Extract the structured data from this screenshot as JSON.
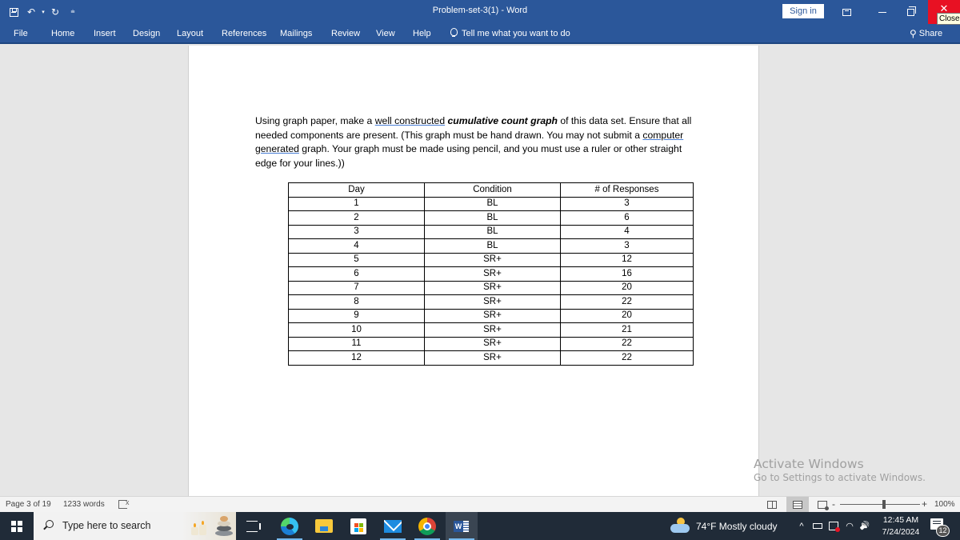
{
  "window": {
    "title": "Problem-set-3(1)  -  Word",
    "sign_in": "Sign in",
    "close_tooltip": "Close",
    "quick_access": [
      "save-icon",
      "undo-icon",
      "redo-icon",
      "customize-icon"
    ]
  },
  "ribbon": {
    "tabs": [
      "File",
      "Home",
      "Insert",
      "Design",
      "Layout",
      "References",
      "Mailings",
      "Review",
      "View",
      "Help"
    ],
    "tell_me": "Tell me what you want to do",
    "share": "Share"
  },
  "document": {
    "paragraph": {
      "p1": "Using graph paper, make a ",
      "u1": "well constructed",
      "p2": " ",
      "bold": "cumulative count graph",
      "p3": " of this data set.  Ensure that all needed components are present.  (This graph must be hand drawn.  You may not submit a ",
      "u2": "computer generated",
      "p4": " graph.  Your graph must be made using pencil, and you must use a ruler or other straight edge for your lines.))"
    },
    "table": {
      "headers": [
        "Day",
        "Condition",
        "# of Responses"
      ],
      "rows": [
        [
          "1",
          "BL",
          "3"
        ],
        [
          "2",
          "BL",
          "6"
        ],
        [
          "3",
          "BL",
          "4"
        ],
        [
          "4",
          "BL",
          "3"
        ],
        [
          "5",
          "SR+",
          "12"
        ],
        [
          "6",
          "SR+",
          "16"
        ],
        [
          "7",
          "SR+",
          "20"
        ],
        [
          "8",
          "SR+",
          "22"
        ],
        [
          "9",
          "SR+",
          "20"
        ],
        [
          "10",
          "SR+",
          "21"
        ],
        [
          "11",
          "SR+",
          "22"
        ],
        [
          "12",
          "SR+",
          "22"
        ]
      ]
    }
  },
  "watermark": {
    "title": "Activate Windows",
    "subtitle": "Go to Settings to activate Windows."
  },
  "statusbar": {
    "page": "Page 3 of 19",
    "words": "1233 words",
    "zoom_minus": "-",
    "zoom_plus": "+",
    "zoom_percent": "100%",
    "zoom_level": 1.0
  },
  "taskbar": {
    "search_placeholder": "Type here to search",
    "apps": [
      "task-view",
      "edge",
      "file-explorer",
      "microsoft-store",
      "mail",
      "chrome",
      "word"
    ],
    "weather": "74°F  Mostly cloudy",
    "time": "12:45 AM",
    "date": "7/24/2024",
    "notification_count": "12",
    "tray_chevron": "^",
    "volume": "🔊"
  }
}
